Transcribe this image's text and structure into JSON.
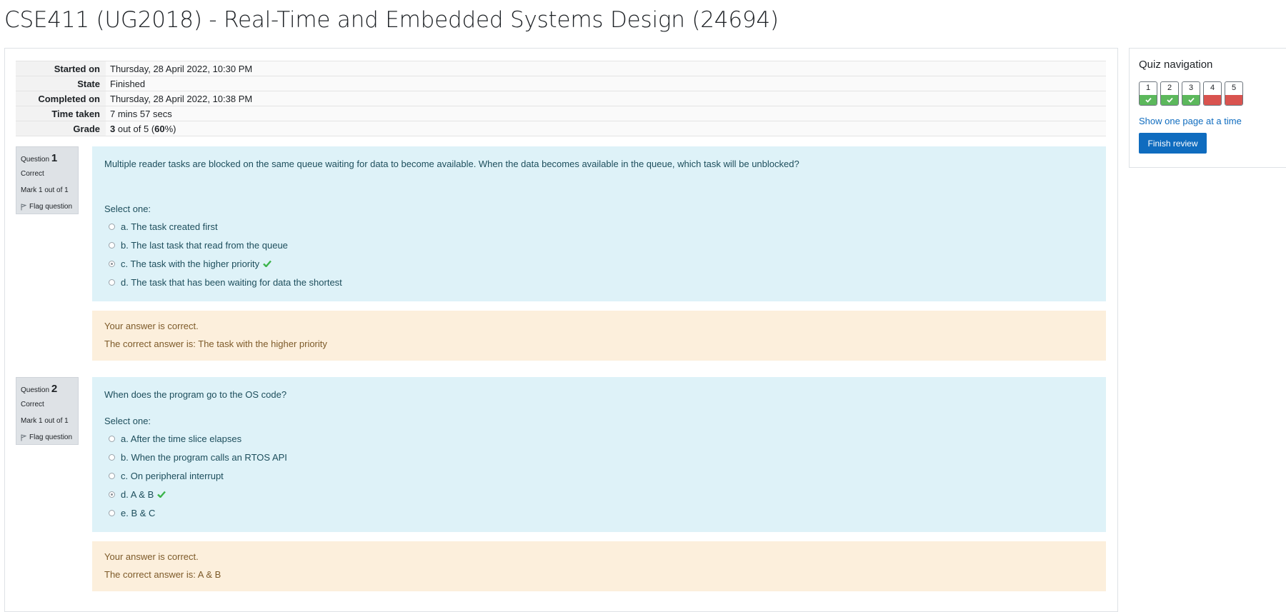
{
  "page": {
    "title": "CSE411 (UG2018) - Real-Time and Embedded Systems Design (24694)"
  },
  "summary": {
    "started_label": "Started on",
    "started_value": "Thursday, 28 April 2022, 10:30 PM",
    "state_label": "State",
    "state_value": "Finished",
    "completed_label": "Completed on",
    "completed_value": "Thursday, 28 April 2022, 10:38 PM",
    "time_label": "Time taken",
    "time_value": "7 mins 57 secs",
    "grade_label": "Grade",
    "grade_score": "3",
    "grade_mid": " out of 5 (",
    "grade_percent": "60",
    "grade_end": "%)"
  },
  "questions": [
    {
      "label": "Question",
      "number": "1",
      "status": "Correct",
      "mark": "Mark 1 out of 1",
      "flag": "Flag question",
      "text": "Multiple reader tasks are blocked on the same queue waiting for data to become available. When the data becomes available in the queue, which task will be unblocked?",
      "prompt": "Select one:",
      "options": [
        {
          "label": "a. The task created first",
          "checked": false,
          "correct": false
        },
        {
          "label": "b. The last task that read from the queue",
          "checked": false,
          "correct": false
        },
        {
          "label": "c. The task with the higher priority",
          "checked": true,
          "correct": true
        },
        {
          "label": "d. The task that has been waiting for data the shortest",
          "checked": false,
          "correct": false
        }
      ],
      "feedback": "Your answer is correct.",
      "right_answer": "The correct answer is: The task with the higher priority"
    },
    {
      "label": "Question",
      "number": "2",
      "status": "Correct",
      "mark": "Mark 1 out of 1",
      "flag": "Flag question",
      "text": "When does the program go to the OS code?",
      "prompt": "Select one:",
      "options": [
        {
          "label": "a. After the time slice elapses",
          "checked": false,
          "correct": false
        },
        {
          "label": "b. When the program calls an RTOS API",
          "checked": false,
          "correct": false
        },
        {
          "label": "c. On peripheral interrupt",
          "checked": false,
          "correct": false
        },
        {
          "label": "d. A & B",
          "checked": true,
          "correct": true
        },
        {
          "label": "e. B & C",
          "checked": false,
          "correct": false
        }
      ],
      "feedback": "Your answer is correct.",
      "right_answer": "The correct answer is: A & B"
    }
  ],
  "nav": {
    "title": "Quiz navigation",
    "buttons": [
      {
        "num": "1",
        "state": "correct"
      },
      {
        "num": "2",
        "state": "correct"
      },
      {
        "num": "3",
        "state": "correct"
      },
      {
        "num": "4",
        "state": "incorrect"
      },
      {
        "num": "5",
        "state": "incorrect"
      }
    ],
    "show_one_page": "Show one page at a time",
    "finish_review": "Finish review"
  },
  "colors": {
    "formulation_bg": "#def2f8",
    "feedback_bg": "#fcefdc",
    "correct": "#5cb85c",
    "incorrect": "#d9534f",
    "primary": "#0f6cbf"
  }
}
